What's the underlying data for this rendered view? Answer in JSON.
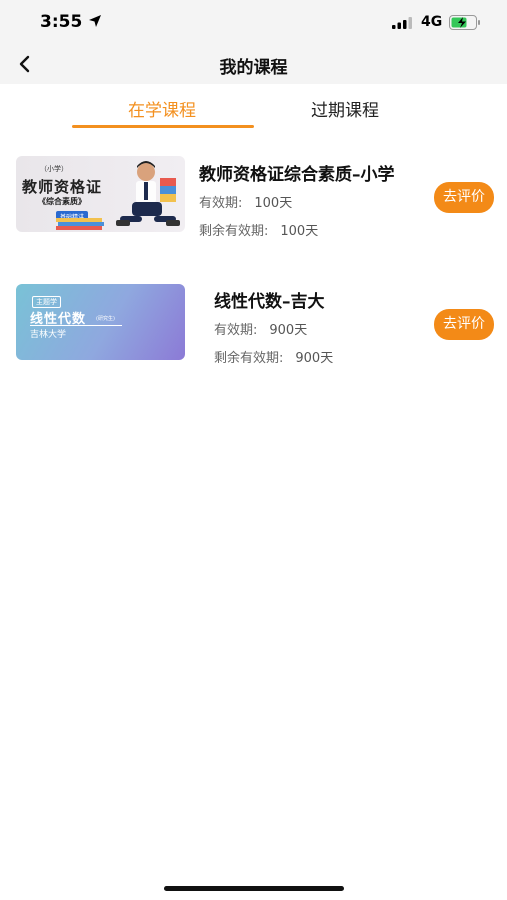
{
  "status": {
    "time": "3:55",
    "network": "4G"
  },
  "nav": {
    "title": "我的课程"
  },
  "tabs": [
    {
      "label": "在学课程",
      "active": true
    },
    {
      "label": "过期课程",
      "active": false
    }
  ],
  "courses": [
    {
      "title": "教师资格证综合素质–小学",
      "validity_label": "有效期:",
      "validity_value": "100天",
      "remaining_label": "剩余有效期:",
      "remaining_value": "100天",
      "action": "去评价",
      "thumb": {
        "tag": "（小学）",
        "headline": "教师资格证",
        "sub": "《综合素质》",
        "badge": "基础精讲"
      }
    },
    {
      "title": "线性代数–吉大",
      "validity_label": "有效期:",
      "validity_value": "900天",
      "remaining_label": "剩余有效期:",
      "remaining_value": "900天",
      "action": "去评价",
      "thumb": {
        "tag": "主题学",
        "headline": "线性代数",
        "sub": "吉林大学",
        "badge": "(研究生)"
      }
    }
  ],
  "colors": {
    "accent": "#f3901f",
    "button": "#f38a17"
  }
}
